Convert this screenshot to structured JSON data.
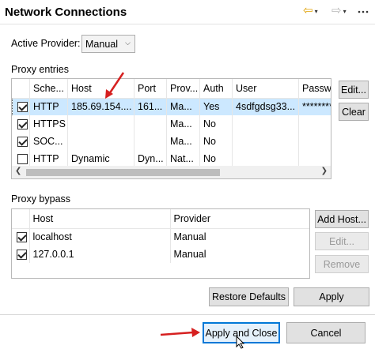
{
  "window": {
    "title": "Network Connections"
  },
  "nav": {
    "back_icon": "back-arrow-icon",
    "forward_icon": "forward-arrow-icon",
    "caret": "▾"
  },
  "provider": {
    "label": "Active Provider:",
    "value": "Manual"
  },
  "proxy_entries": {
    "label": "Proxy entries",
    "columns": [
      "Sche...",
      "Host",
      "Port",
      "Prov...",
      "Auth",
      "User",
      "Passwor"
    ],
    "rows": [
      {
        "checked": true,
        "scheme": "HTTP",
        "host": "185.69.154....",
        "port": "161...",
        "provider": "Ma...",
        "auth": "Yes",
        "user": "4sdfgdsg33...",
        "password": "*********",
        "selected": true
      },
      {
        "checked": true,
        "scheme": "HTTPS",
        "host": "",
        "port": "",
        "provider": "Ma...",
        "auth": "No",
        "user": "",
        "password": "",
        "selected": false
      },
      {
        "checked": true,
        "scheme": "SOC...",
        "host": "",
        "port": "",
        "provider": "Ma...",
        "auth": "No",
        "user": "",
        "password": "",
        "selected": false
      },
      {
        "checked": false,
        "scheme": "HTTP",
        "host": "Dynamic",
        "port": "Dyn...",
        "provider": "Nat...",
        "auth": "No",
        "user": "",
        "password": "",
        "selected": false
      }
    ],
    "buttons": {
      "edit": "Edit...",
      "clear": "Clear"
    }
  },
  "proxy_bypass": {
    "label": "Proxy bypass",
    "columns": [
      "Host",
      "Provider"
    ],
    "rows": [
      {
        "checked": true,
        "host": "localhost",
        "provider": "Manual"
      },
      {
        "checked": true,
        "host": "127.0.0.1",
        "provider": "Manual"
      }
    ],
    "buttons": {
      "add_host": "Add Host...",
      "edit": "Edit...",
      "remove": "Remove"
    }
  },
  "actions": {
    "restore_defaults": "Restore Defaults",
    "apply": "Apply",
    "apply_and_close": "Apply and Close",
    "cancel": "Cancel"
  },
  "colors": {
    "selection": "#cce8ff",
    "annotation": "#d62020",
    "focus": "#0078d7"
  }
}
